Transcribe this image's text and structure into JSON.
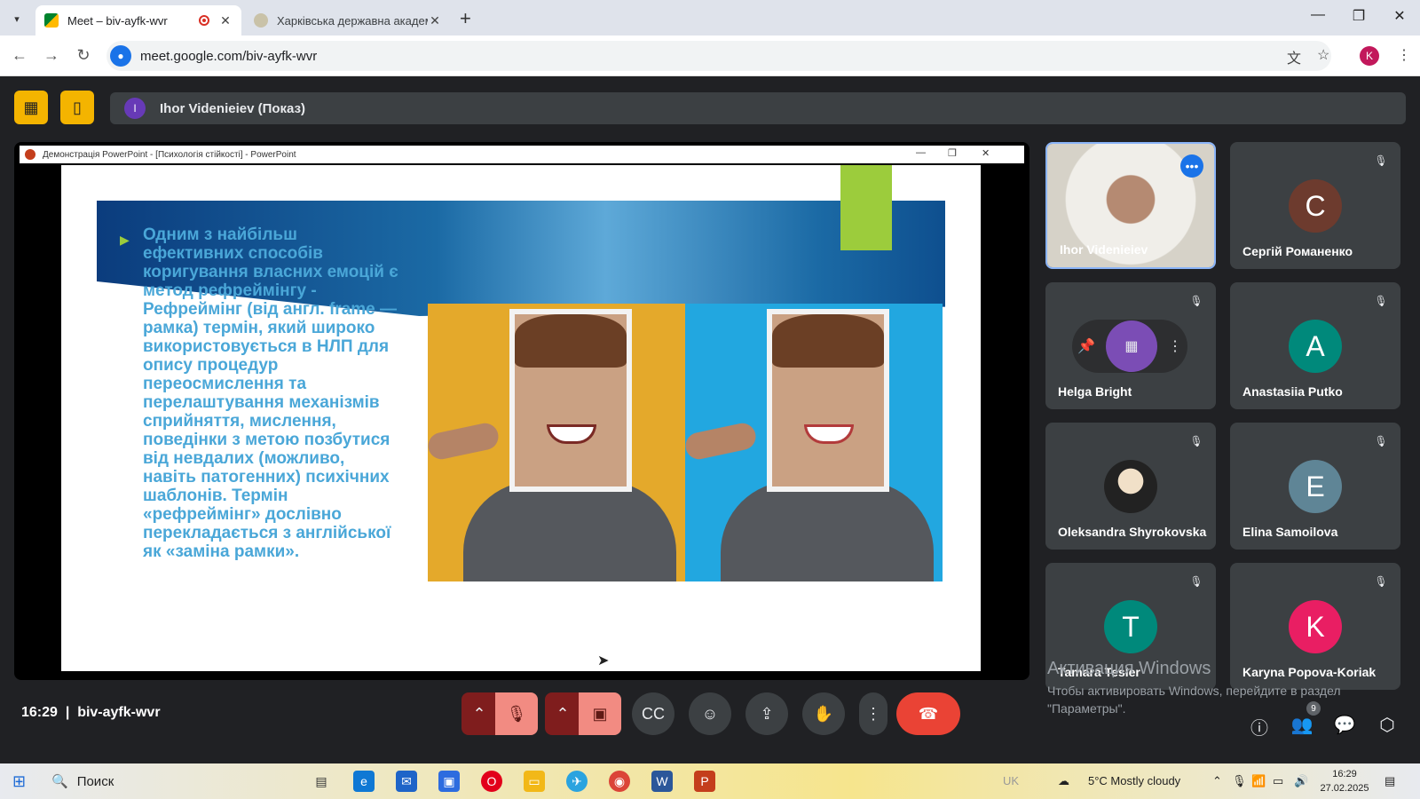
{
  "browser": {
    "tabs": [
      {
        "title": "Meet – biv-ayfk-wvr",
        "active": true
      },
      {
        "title": "Харківська державна академі",
        "active": false
      }
    ],
    "url": "meet.google.com/biv-ayfk-wvr",
    "profile_initial": "K"
  },
  "meet": {
    "presenter_initial": "I",
    "presenter_label": "Ihor Videnieiev (Показ)",
    "powerpoint_title": "Демонстрація PowerPoint - [Психологія стійкості] - PowerPoint",
    "slide_text": "Одним з найбільш ефективних способів коригування власних емоцій є метод рефреймінгу - Рефреймінг (від англ. frame — рамка) термін, який широко використовується в НЛП для опису процедур переосмислення та перелаштування механізмів сприйняття, мислення, поведінки з метою позбутися від невдалих (можливо, навіть патогенних) психічних шаблонів. Термін «рефреймінг» дослівно перекладається з англійської як «заміна рамки».",
    "participants": [
      {
        "name": "Ihor Videnieiev",
        "initial": "",
        "color": ""
      },
      {
        "name": "Сергій Романенко",
        "initial": "С",
        "color": "#6d3b2e"
      },
      {
        "name": "Helga Bright",
        "initial": "",
        "color": "#7b4db5"
      },
      {
        "name": "Anastasiia Putko",
        "initial": "A",
        "color": "#00897b"
      },
      {
        "name": "Oleksandra Shyrokovska",
        "initial": "",
        "color": "#222"
      },
      {
        "name": "Elina Samoilova",
        "initial": "E",
        "color": "#5f8596"
      },
      {
        "name": "Tamara Tesler",
        "initial": "T",
        "color": "#00897b"
      },
      {
        "name": "Karyna Popova-Koriak",
        "initial": "K",
        "color": "#e91e63"
      }
    ],
    "time": "16:29",
    "meeting_code": "biv-ayfk-wvr",
    "people_count": "9"
  },
  "watermark": {
    "title": "Активация Windows",
    "subtitle": "Чтобы активировать Windows, перейдите в раздел \"Параметры\"."
  },
  "taskbar": {
    "search_label": "Поиск",
    "weather": "5°C  Mostly cloudy",
    "lang": "UK",
    "time": "16:29",
    "date": "27.02.2025"
  }
}
